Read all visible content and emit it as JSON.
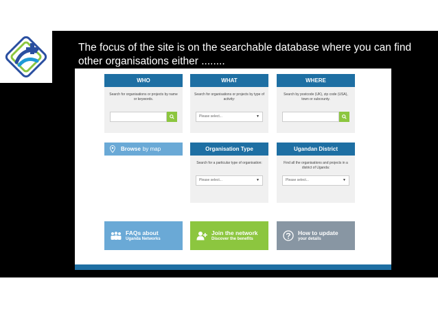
{
  "slide": {
    "caption": "The focus of the site is on the searchable database where you can find other organisations either ........"
  },
  "panels": {
    "who": {
      "title": "WHO",
      "description": "Search for organisations or projects by name or keywords.",
      "input_placeholder": "",
      "button_icon": "search-icon"
    },
    "what": {
      "title": "WHAT",
      "description": "Search for organisations or projects by type of activity:",
      "select_value": "Please select..."
    },
    "where": {
      "title": "WHERE",
      "description": "Search by postcode (UK), zip code (USA), town or subcounty.",
      "input_placeholder": "",
      "button_icon": "search-icon"
    },
    "org_type": {
      "title": "Organisation Type",
      "description": "Search for a particular type of organisation:",
      "select_value": "Please select..."
    },
    "district": {
      "title": "Ugandan District",
      "description": "Find all the organisations and projects in a district of Uganda:",
      "select_value": "Please select..."
    }
  },
  "browse_map": {
    "label_strong": "Browse",
    "label_light": "by map",
    "icon": "map-pin-icon"
  },
  "tiles": [
    {
      "title": "FAQs about",
      "subtitle": "Uganda Networks",
      "icon": "people-icon",
      "color": "#6aa9d6"
    },
    {
      "title": "Join the network",
      "subtitle": "Discover the benefits",
      "icon": "add-user-icon",
      "color": "#8cc63f"
    },
    {
      "title": "How to update",
      "subtitle": "your details",
      "icon": "question-icon",
      "color": "#8896a3"
    }
  ],
  "colors": {
    "header_blue": "#1e6fa3",
    "green": "#8cc63f",
    "light_blue": "#6aa9d6",
    "grey": "#8896a3",
    "panel_bg": "#f0f0f0"
  }
}
